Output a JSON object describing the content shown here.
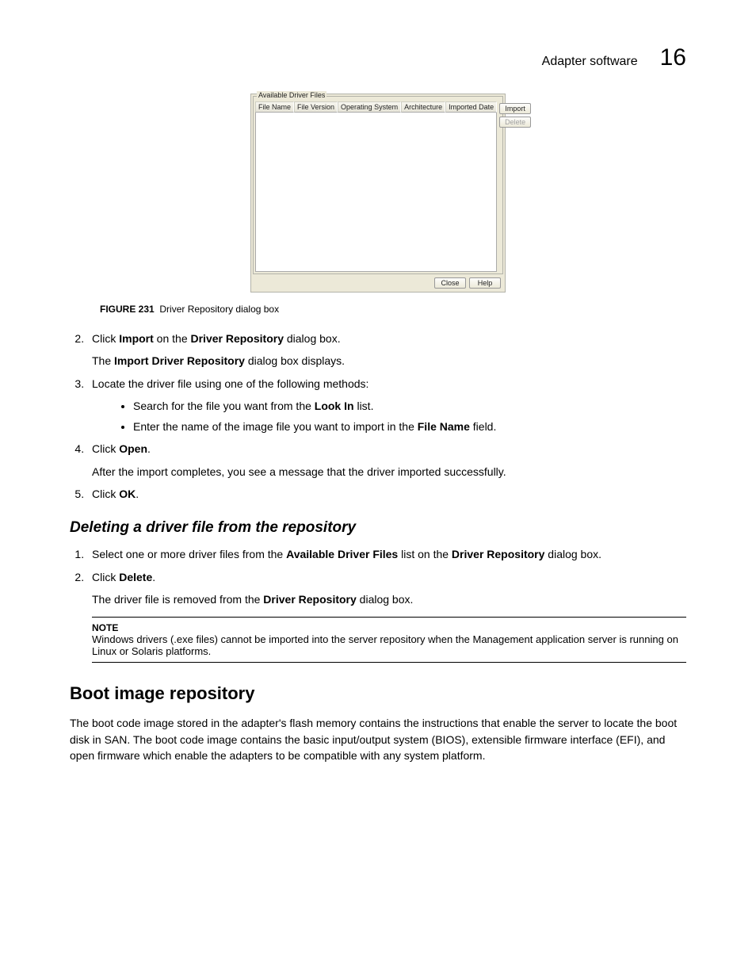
{
  "header": {
    "section": "Adapter software",
    "chapter": "16"
  },
  "dialog": {
    "groupTitle": "Available Driver Files",
    "columns": [
      "File Name",
      "File Version",
      "Operating System",
      "Architecture",
      "Imported Date"
    ],
    "buttons": {
      "import": "Import",
      "delete": "Delete",
      "close": "Close",
      "help": "Help"
    }
  },
  "caption": {
    "label": "FIGURE 231",
    "text": "Driver Repository dialog box"
  },
  "steps1": {
    "s2a": "Click ",
    "s2b": "Import",
    "s2c": " on the ",
    "s2d": "Driver Repository",
    "s2e": " dialog box.",
    "s2f": "The ",
    "s2g": "Import Driver Repository",
    "s2h": " dialog box displays.",
    "s3": "Locate the driver file using one of the following methods:",
    "b1a": "Search for the file you want from the ",
    "b1b": "Look In",
    "b1c": " list.",
    "b2a": "Enter the name of the image file you want to import in the ",
    "b2b": "File Name",
    "b2c": " field.",
    "s4a": "Click ",
    "s4b": "Open",
    "s4c": ".",
    "s4d": "After the import completes, you see a message that the driver imported successfully.",
    "s5a": "Click ",
    "s5b": "OK",
    "s5c": "."
  },
  "heading1": "Deleting a driver file from the repository",
  "steps2": {
    "s1a": "Select one or more driver files from the ",
    "s1b": "Available Driver Files",
    "s1c": " list on the ",
    "s1d": "Driver Repository",
    "s1e": " dialog box.",
    "s2a": "Click ",
    "s2b": "Delete",
    "s2c": ".",
    "s2d": "The driver file is removed from the ",
    "s2e": "Driver Repository",
    "s2f": " dialog box."
  },
  "note": {
    "label": "NOTE",
    "text": "Windows drivers (.exe files) cannot be imported into the server repository when the Management application server is running on Linux or Solaris platforms."
  },
  "heading2": "Boot image repository",
  "para1": "The boot code image stored in the adapter's flash memory contains the instructions that enable the server to locate the boot disk in SAN. The boot code image contains the basic input/output system (BIOS), extensible firmware interface (EFI), and open firmware which enable the adapters to be compatible with any system platform."
}
